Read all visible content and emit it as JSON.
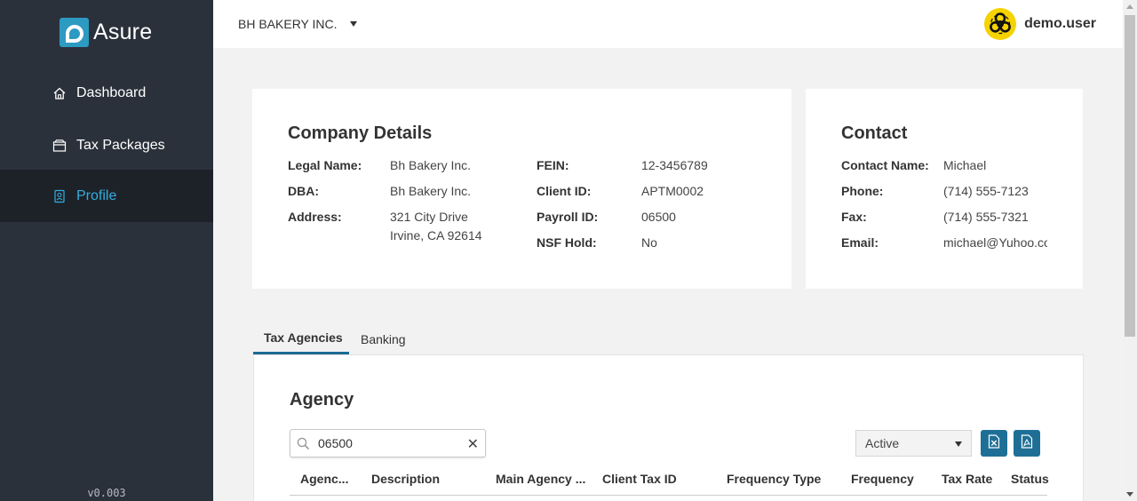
{
  "sidebar": {
    "logo_text": "Asure",
    "items": [
      {
        "label": "Dashboard",
        "icon": "home-icon"
      },
      {
        "label": "Tax Packages",
        "icon": "package-icon"
      },
      {
        "label": "Profile",
        "icon": "profile-icon",
        "active": true
      }
    ],
    "version": "v0.003"
  },
  "topbar": {
    "company": "BH BAKERY INC.",
    "username": "demo.user",
    "avatar_icon": "biohazard-icon"
  },
  "company_details": {
    "title": "Company Details",
    "legal_name_label": "Legal Name:",
    "legal_name": "Bh Bakery Inc.",
    "dba_label": "DBA:",
    "dba": "Bh Bakery Inc.",
    "address_label": "Address:",
    "address_line1": "321 City Drive",
    "address_line2": "Irvine, CA 92614",
    "fein_label": "FEIN:",
    "fein": "12-3456789",
    "client_id_label": "Client ID:",
    "client_id": "APTM0002",
    "payroll_id_label": "Payroll ID:",
    "payroll_id": "06500",
    "nsf_hold_label": "NSF Hold:",
    "nsf_hold": "No"
  },
  "contact": {
    "title": "Contact",
    "name_label": "Contact Name:",
    "name": "Michael",
    "phone_label": "Phone:",
    "phone": "(714) 555-7123",
    "fax_label": "Fax:",
    "fax": "(714) 555-7321",
    "email_label": "Email:",
    "email": "michael@Yuhoo.co"
  },
  "tabs": [
    {
      "label": "Tax Agencies",
      "active": true
    },
    {
      "label": "Banking",
      "active": false
    }
  ],
  "agency": {
    "title": "Agency",
    "search_value": "06500",
    "status_filter": "Active",
    "columns": [
      "Agenc...",
      "Description",
      "Main Agency ...",
      "Client Tax ID",
      "Frequency Type",
      "Frequency",
      "Tax Rate",
      "Status"
    ]
  },
  "colors": {
    "sidebar_bg": "#2b313b",
    "sidebar_active_bg": "#1d2229",
    "accent": "#33aee0",
    "button": "#1e6f96"
  }
}
